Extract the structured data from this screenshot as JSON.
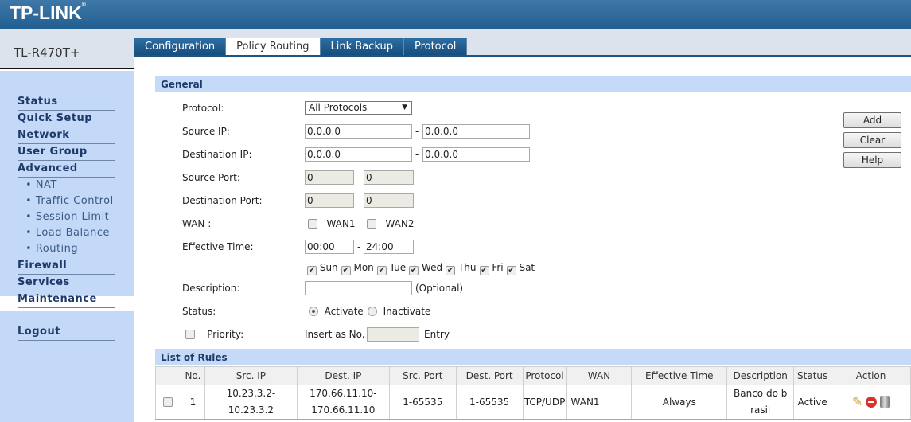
{
  "brand": "TP-LINK",
  "model": "TL-R470T+",
  "sidebar": {
    "items": [
      "Status",
      "Quick Setup",
      "Network",
      "User Group",
      "Advanced"
    ],
    "sub": [
      "NAT",
      "Traffic Control",
      "Session Limit",
      "Load Balance",
      "Routing"
    ],
    "selected": "Load Balance",
    "items2": [
      "Firewall",
      "Services",
      "Maintenance"
    ],
    "logout": "Logout"
  },
  "tabs": [
    "Configuration",
    "Policy Routing",
    "Link Backup",
    "Protocol"
  ],
  "active_tab": "Policy Routing",
  "general": {
    "title": "General",
    "protocol_label": "Protocol:",
    "protocol_value": "All Protocols",
    "src_ip_label": "Source IP:",
    "src_ip_from": "0.0.0.0",
    "src_ip_to": "0.0.0.0",
    "dst_ip_label": "Destination IP:",
    "dst_ip_from": "0.0.0.0",
    "dst_ip_to": "0.0.0.0",
    "src_port_label": "Source Port:",
    "src_port_from": "0",
    "src_port_to": "0",
    "dst_port_label": "Destination Port:",
    "dst_port_from": "0",
    "dst_port_to": "0",
    "wan_label": "WAN :",
    "wan1": "WAN1",
    "wan2": "WAN2",
    "time_label": "Effective Time:",
    "time_from": "00:00",
    "time_to": "24:00",
    "days": [
      "Sun",
      "Mon",
      "Tue",
      "Wed",
      "Thu",
      "Fri",
      "Sat"
    ],
    "desc_label": "Description:",
    "desc_value": "",
    "optional": "(Optional)",
    "status_label": "Status:",
    "activate": "Activate",
    "inactivate": "Inactivate",
    "status_selected": "Activate",
    "priority_label": "Priority:",
    "insert_as": "Insert as No.",
    "insert_value": "",
    "entry": "Entry",
    "dash": "-"
  },
  "buttons": {
    "add": "Add",
    "clear": "Clear",
    "help": "Help"
  },
  "rules": {
    "title": "List of Rules",
    "columns": [
      "No.",
      "Src. IP",
      "Dest. IP",
      "Src. Port",
      "Dest. Port",
      "Protocol",
      "WAN",
      "Effective Time",
      "Description",
      "Status",
      "Action"
    ],
    "rows": [
      {
        "no": "1",
        "src_ip": "10.23.3.2-10.23.3.2",
        "dst_ip": "170.66.11.10-170.66.11.10",
        "src_port": "1-65535",
        "dst_port": "1-65535",
        "protocol": "TCP/UDP",
        "wan": "WAN1",
        "time": "Always",
        "desc": "Banco do brasil",
        "status": "Active"
      }
    ]
  },
  "colors": {
    "header": "#215f90",
    "sidebar": "#c4d9f7",
    "section": "#c5daf7"
  }
}
